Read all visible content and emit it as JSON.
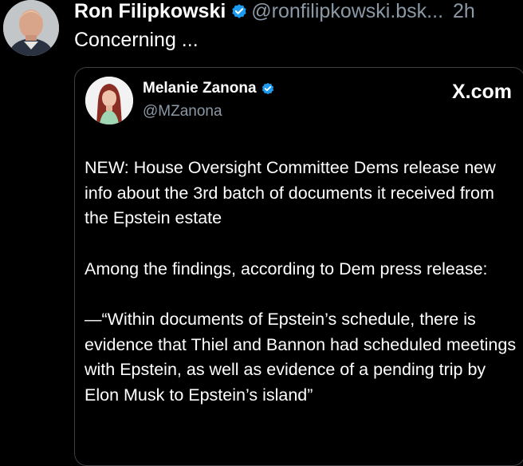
{
  "post": {
    "author_name": "Ron Filipkowski",
    "handle": "@ronfilipkowski.bsk...",
    "timestamp": "2h",
    "text": "Concerning ..."
  },
  "embed": {
    "author_name": "Melanie Zanona",
    "handle": "@MZanona",
    "source": "X.com",
    "paragraphs": [
      "NEW: House Oversight Committee Dems release new info about the 3rd batch of documents it received from the Epstein estate",
      "Among the findings, according to Dem press release:",
      "—“Within documents of Epstein’s schedule, there is evidence that Thiel and Bannon had scheduled meetings with Epstein, as well as evidence of a pending trip by Elon Musk to Epstein’s island”"
    ]
  },
  "colors": {
    "background": "#000000",
    "text": "#ffffff",
    "secondary_text": "#8b98a5",
    "verified_badge": "#1d9bf0",
    "embed_border": "#3a3d42"
  }
}
